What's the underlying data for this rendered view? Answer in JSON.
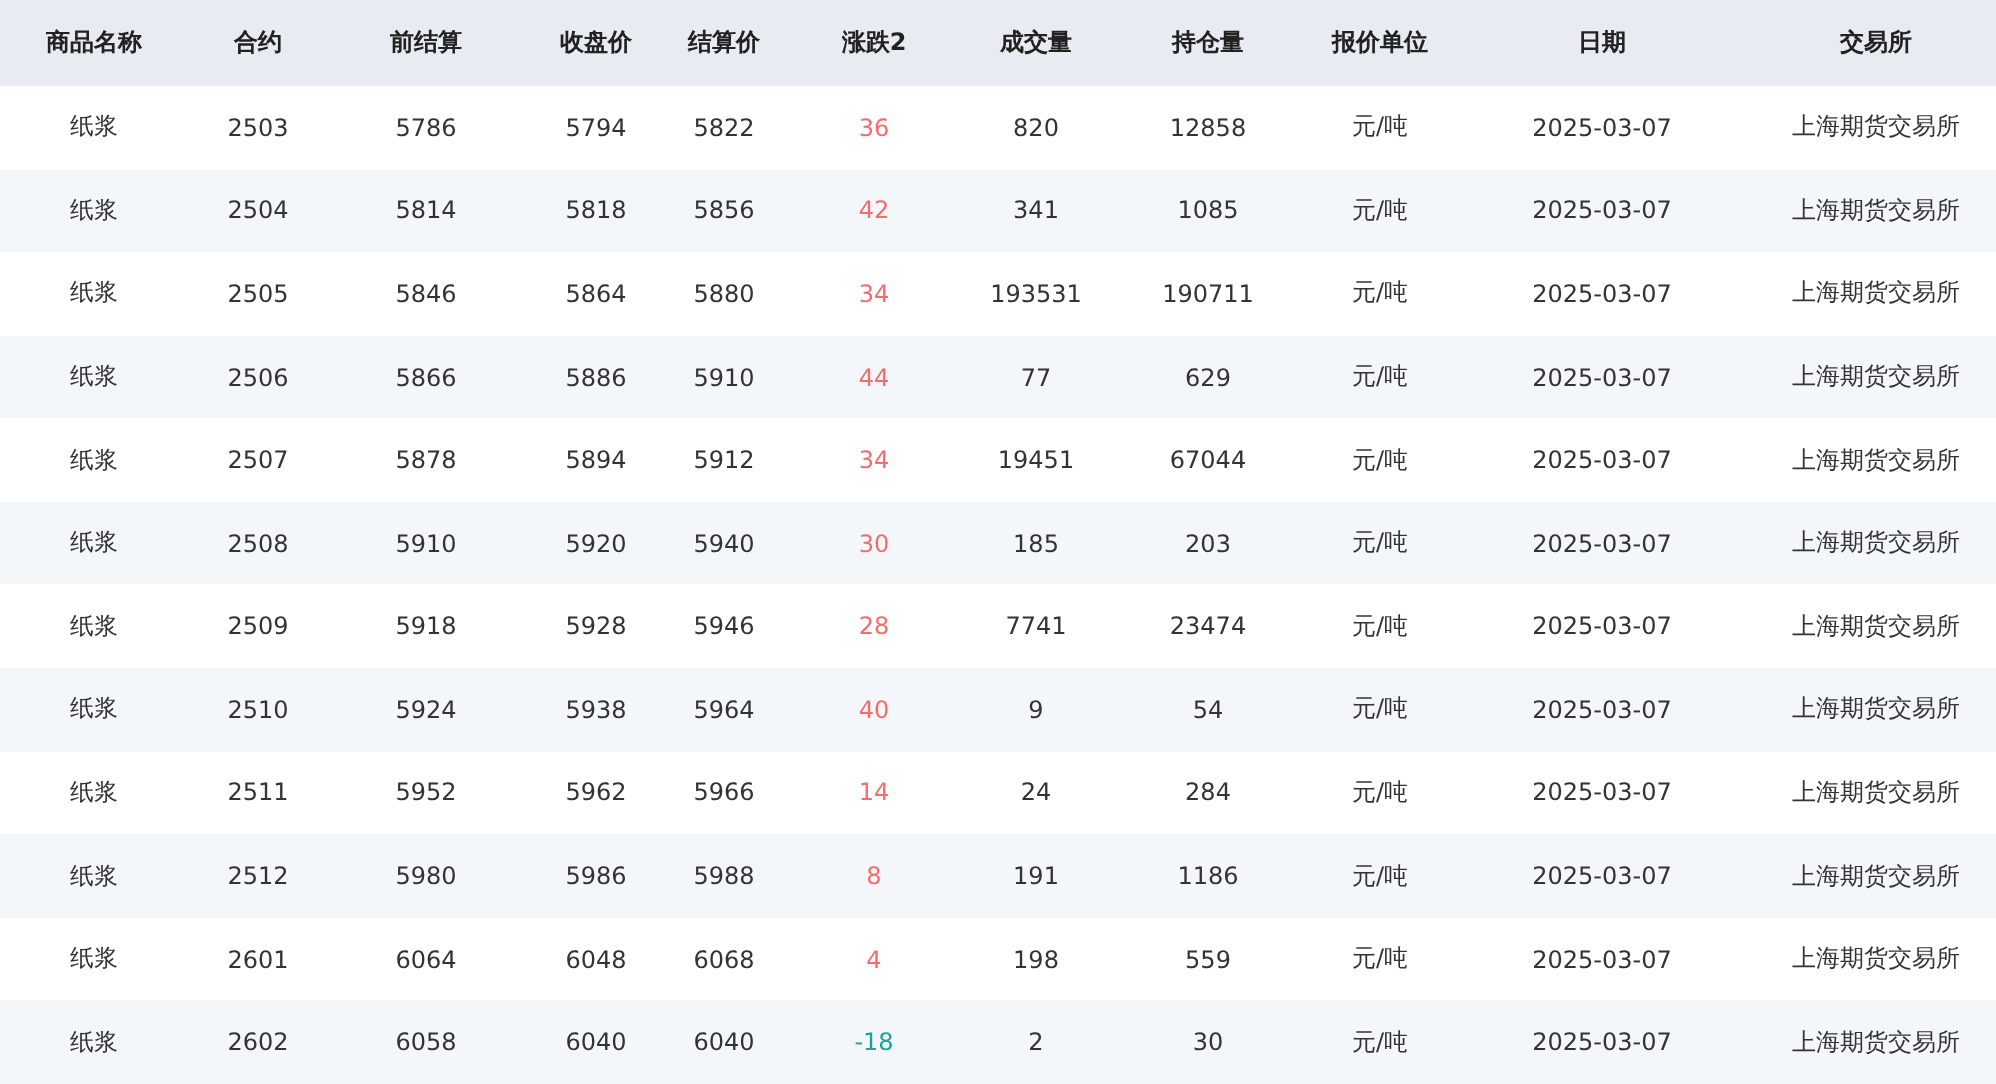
{
  "table": {
    "columns": [
      "商品名称",
      "合约",
      "前结算",
      "收盘价",
      "结算价",
      "涨跌2",
      "成交量",
      "持仓量",
      "报价单位",
      "日期",
      "交易所"
    ],
    "rows": [
      {
        "cells": [
          "纸浆",
          "2503",
          "5786",
          "5794",
          "5822",
          {
            "text": "36",
            "color": "#f56c6c"
          },
          "820",
          "12858",
          "元/吨",
          "2025-03-07",
          "上海期货交易所"
        ]
      },
      {
        "cells": [
          "纸浆",
          "2504",
          "5814",
          "5818",
          "5856",
          {
            "text": "42",
            "color": "#f56c6c"
          },
          "341",
          "1085",
          "元/吨",
          "2025-03-07",
          "上海期货交易所"
        ]
      },
      {
        "cells": [
          "纸浆",
          "2505",
          "5846",
          "5864",
          "5880",
          {
            "text": "34",
            "color": "#f56c6c"
          },
          "193531",
          "190711",
          "元/吨",
          "2025-03-07",
          "上海期货交易所"
        ]
      },
      {
        "cells": [
          "纸浆",
          "2506",
          "5866",
          "5886",
          "5910",
          {
            "text": "44",
            "color": "#f56c6c"
          },
          "77",
          "629",
          "元/吨",
          "2025-03-07",
          "上海期货交易所"
        ]
      },
      {
        "cells": [
          "纸浆",
          "2507",
          "5878",
          "5894",
          "5912",
          {
            "text": "34",
            "color": "#f56c6c"
          },
          "19451",
          "67044",
          "元/吨",
          "2025-03-07",
          "上海期货交易所"
        ]
      },
      {
        "cells": [
          "纸浆",
          "2508",
          "5910",
          "5920",
          "5940",
          {
            "text": "30",
            "color": "#f56c6c"
          },
          "185",
          "203",
          "元/吨",
          "2025-03-07",
          "上海期货交易所"
        ]
      },
      {
        "cells": [
          "纸浆",
          "2509",
          "5918",
          "5928",
          "5946",
          {
            "text": "28",
            "color": "#f56c6c"
          },
          "7741",
          "23474",
          "元/吨",
          "2025-03-07",
          "上海期货交易所"
        ]
      },
      {
        "cells": [
          "纸浆",
          "2510",
          "5924",
          "5938",
          "5964",
          {
            "text": "40",
            "color": "#f56c6c"
          },
          "9",
          "54",
          "元/吨",
          "2025-03-07",
          "上海期货交易所"
        ]
      },
      {
        "cells": [
          "纸浆",
          "2511",
          "5952",
          "5962",
          "5966",
          {
            "text": "14",
            "color": "#f56c6c"
          },
          "24",
          "284",
          "元/吨",
          "2025-03-07",
          "上海期货交易所"
        ]
      },
      {
        "cells": [
          "纸浆",
          "2512",
          "5980",
          "5986",
          "5988",
          {
            "text": "8",
            "color": "#f56c6c"
          },
          "191",
          "1186",
          "元/吨",
          "2025-03-07",
          "上海期货交易所"
        ]
      },
      {
        "cells": [
          "纸浆",
          "2601",
          "6064",
          "6048",
          "6068",
          {
            "text": "4",
            "color": "#f56c6c"
          },
          "198",
          "559",
          "元/吨",
          "2025-03-07",
          "上海期货交易所"
        ]
      },
      {
        "cells": [
          "纸浆",
          "2602",
          "6058",
          "6040",
          "6040",
          {
            "text": "-18",
            "color": "#19a598"
          },
          "2",
          "30",
          "元/吨",
          "2025-03-07",
          "上海期货交易所"
        ]
      }
    ]
  }
}
